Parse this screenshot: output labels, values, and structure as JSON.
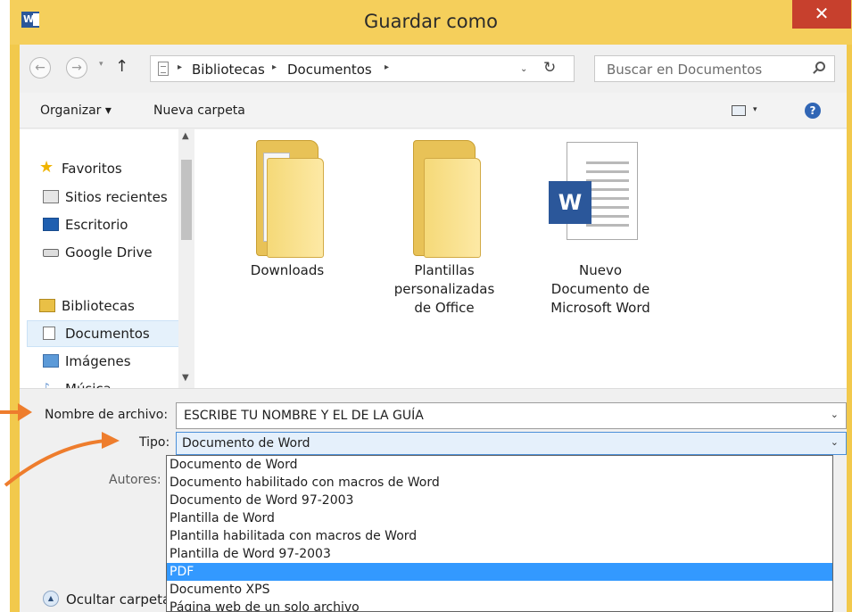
{
  "window": {
    "title": "Guardar como",
    "app_icon_letter": "W",
    "close_glyph": "✕",
    "frame_color": "#f5cf5b"
  },
  "nav_buttons": {
    "back": "←",
    "forward": "→",
    "recent": "▾",
    "up": "↑"
  },
  "address": {
    "crumbs": [
      "Bibliotecas",
      "Documentos"
    ],
    "separator": "▸",
    "dropdown": "⌄",
    "refresh": "↻"
  },
  "search": {
    "placeholder": "Buscar en Documentos"
  },
  "toolbar": {
    "organize": "Organizar ▾",
    "new_folder": "Nueva carpeta",
    "view_dropdown": "▾",
    "help": "?"
  },
  "nav": {
    "favorites": "Favoritos",
    "recent_sites": "Sitios recientes",
    "desktop": "Escritorio",
    "google_drive": "Google Drive",
    "libraries": "Bibliotecas",
    "documents": "Documentos",
    "images": "Imágenes",
    "music_partial": "Música",
    "scroll_up": "▲",
    "scroll_down": "▼"
  },
  "files": [
    {
      "name": "Downloads",
      "kind": "folder"
    },
    {
      "name": "Plantillas personalizadas de Office",
      "lines": [
        "Plantillas",
        "personalizadas",
        "de Office"
      ],
      "kind": "folder"
    },
    {
      "name": "Nuevo Documento de Microsoft Word",
      "lines": [
        "Nuevo",
        "Documento de",
        "Microsoft Word"
      ],
      "kind": "word-document"
    }
  ],
  "form": {
    "filename_label": "Nombre de archivo:",
    "filename_value": "ESCRIBE TU NOMBRE Y EL DE LA GUÍA",
    "type_label": "Tipo:",
    "type_value": "Documento de Word",
    "authors_label": "Autores:",
    "hide_folders": "Ocultar carpetas",
    "chevron": "⌄"
  },
  "type_options": [
    "Documento de Word",
    "Documento habilitado con macros de Word",
    "Documento de Word 97-2003",
    "Plantilla de Word",
    "Plantilla habilitada con macros de Word",
    "Plantilla de Word 97-2003",
    "PDF",
    "Documento XPS",
    "Página web de un solo archivo"
  ],
  "selected_option": "PDF",
  "colors": {
    "accent_selection": "#3399ff",
    "annotation_arrow": "#ee7d2d",
    "word_blue": "#2b579a",
    "close_red": "#c7402d"
  }
}
